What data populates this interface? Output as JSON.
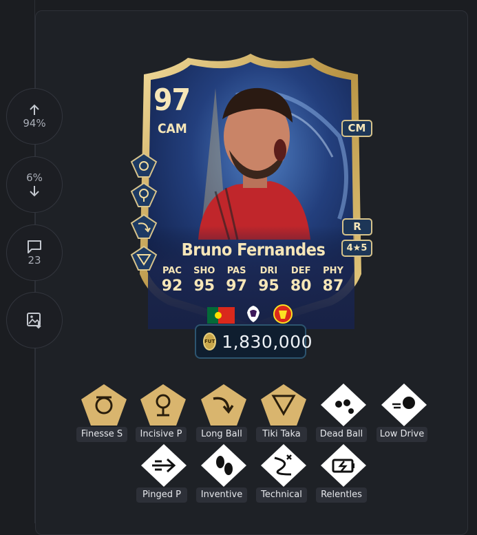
{
  "votes": {
    "up_percent": "94%",
    "down_percent": "6%",
    "comments_count": "23"
  },
  "card": {
    "rating": "97",
    "position": "CAM",
    "alt_positions": [
      "CM"
    ],
    "preferred_foot": "R",
    "skill_weak": "4★5",
    "name": "Bruno Fernandes",
    "stats": [
      {
        "label": "PAC",
        "value": "92"
      },
      {
        "label": "SHO",
        "value": "95"
      },
      {
        "label": "PAS",
        "value": "97"
      },
      {
        "label": "DRI",
        "value": "95"
      },
      {
        "label": "DEF",
        "value": "80"
      },
      {
        "label": "PHY",
        "value": "87"
      }
    ],
    "nation": "Portugal",
    "league": "Premier League",
    "club": "Manchester United"
  },
  "price": {
    "currency_icon": "FUT",
    "value": "1,830,000"
  },
  "playstyles": [
    {
      "label": "Finesse S",
      "kind": "plus",
      "icon": "finesse-shot-icon"
    },
    {
      "label": "Incisive P",
      "kind": "plus",
      "icon": "incisive-pass-icon"
    },
    {
      "label": "Long Ball",
      "kind": "plus",
      "icon": "long-ball-pass-icon"
    },
    {
      "label": "Tiki Taka",
      "kind": "plus",
      "icon": "tiki-taka-icon"
    },
    {
      "label": "Dead Ball",
      "kind": "regular",
      "icon": "dead-ball-icon"
    },
    {
      "label": "Low Drive",
      "kind": "regular",
      "icon": "low-driven-shot-icon"
    },
    {
      "label": "Pinged P",
      "kind": "regular",
      "icon": "pinged-pass-icon"
    },
    {
      "label": "Inventive",
      "kind": "regular",
      "icon": "inventive-icon"
    },
    {
      "label": "Technical",
      "kind": "regular",
      "icon": "technical-icon"
    },
    {
      "label": "Relentles",
      "kind": "regular",
      "icon": "relentless-icon"
    }
  ],
  "colors": {
    "gold": "#e3c27e",
    "card_blue": "#1d3f78",
    "panel": "#1e2126"
  }
}
